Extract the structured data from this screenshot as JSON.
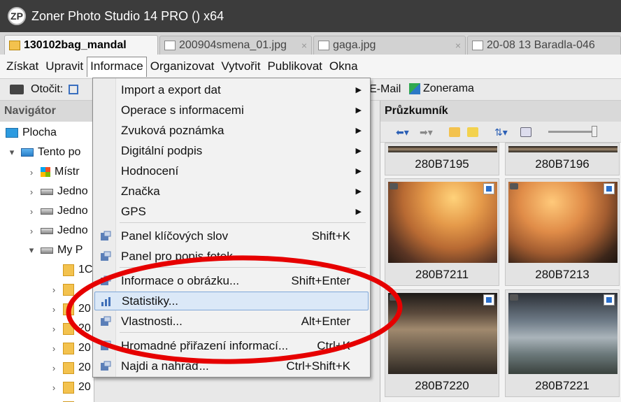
{
  "window": {
    "title": "Zoner Photo Studio 14 PRO  () x64",
    "logo_glyph": "ZP"
  },
  "tabs": [
    {
      "label": "130102bag_mandal",
      "active": true
    },
    {
      "label": "200904smena_01.jpg",
      "active": false
    },
    {
      "label": "gaga.jpg",
      "active": false
    },
    {
      "label": "20-08 13 Baradla-046",
      "active": false
    }
  ],
  "menubar": [
    "Získat",
    "Upravit",
    "Informace",
    "Organizovat",
    "Vytvořit",
    "Publikovat",
    "Okna"
  ],
  "toolbar": {
    "rotate_label": "Otočit:",
    "email_label": "E-Mail",
    "zonerama_label": "Zonerama"
  },
  "navigator": {
    "title": "Navigátor",
    "items": [
      {
        "label": "Plocha",
        "icon": "desktop-icon",
        "expander": ""
      },
      {
        "label": "Tento po",
        "icon": "computer-icon",
        "expander": "▾"
      },
      {
        "label": "Místr",
        "icon": "windows-drive-icon",
        "expander": "›"
      },
      {
        "label": "Jedno",
        "icon": "drive-icon",
        "expander": "›"
      },
      {
        "label": "Jedno",
        "icon": "drive-icon",
        "expander": "›"
      },
      {
        "label": "Jedno",
        "icon": "drive-icon",
        "expander": "›"
      },
      {
        "label": "My P",
        "icon": "drive-icon",
        "expander": "▾"
      },
      {
        "label": "1C",
        "icon": "folder-icon",
        "expander": ""
      },
      {
        "label": "",
        "icon": "folder-icon",
        "expander": "›"
      },
      {
        "label": "20",
        "icon": "folder-icon",
        "expander": "›"
      },
      {
        "label": "20",
        "icon": "folder-icon",
        "expander": "›"
      },
      {
        "label": "20",
        "icon": "folder-icon",
        "expander": "›"
      },
      {
        "label": "20",
        "icon": "folder-icon",
        "expander": "›"
      },
      {
        "label": "20",
        "icon": "folder-icon",
        "expander": "›"
      },
      {
        "label": "2010",
        "icon": "folder-icon",
        "expander": "›"
      }
    ]
  },
  "explorer": {
    "title": "Průzkumník",
    "thumbnails": [
      {
        "name": "280B7195"
      },
      {
        "name": "280B7196"
      },
      {
        "name": "280B7211"
      },
      {
        "name": "280B7213"
      },
      {
        "name": "280B7220"
      },
      {
        "name": "280B7221"
      }
    ]
  },
  "info_menu": {
    "items": [
      {
        "label": "Import a export dat",
        "shortcut": "",
        "submenu": true
      },
      {
        "label": "Operace s informacemi",
        "shortcut": "",
        "submenu": true
      },
      {
        "label": "Zvuková poznámka",
        "shortcut": "",
        "submenu": true
      },
      {
        "label": "Digitální podpis",
        "shortcut": "",
        "submenu": true
      },
      {
        "label": "Hodnocení",
        "shortcut": "",
        "submenu": true
      },
      {
        "label": "Značka",
        "shortcut": "",
        "submenu": true
      },
      {
        "label": "GPS",
        "shortcut": "",
        "submenu": true
      },
      {
        "label": "Panel klíčových slov",
        "shortcut": "Shift+K",
        "submenu": false
      },
      {
        "label": "Panel pro popis fotek",
        "shortcut": "",
        "submenu": false
      },
      {
        "label": "Informace o obrázku...",
        "shortcut": "Shift+Enter",
        "submenu": false
      },
      {
        "label": "Statistiky...",
        "shortcut": "",
        "submenu": false,
        "highlighted": true
      },
      {
        "label": "Vlastnosti...",
        "shortcut": "Alt+Enter",
        "submenu": false
      },
      {
        "label": "Hromadné přiřazení informací...",
        "shortcut": "Ctrl+K",
        "submenu": false
      },
      {
        "label": "Najdi a nahraď...",
        "shortcut": "Ctrl+Shift+K",
        "submenu": false
      }
    ]
  },
  "colors": {
    "titlebar": "#3c3c3c",
    "highlight": "#dbe8f7",
    "annotation": "#e60000"
  }
}
